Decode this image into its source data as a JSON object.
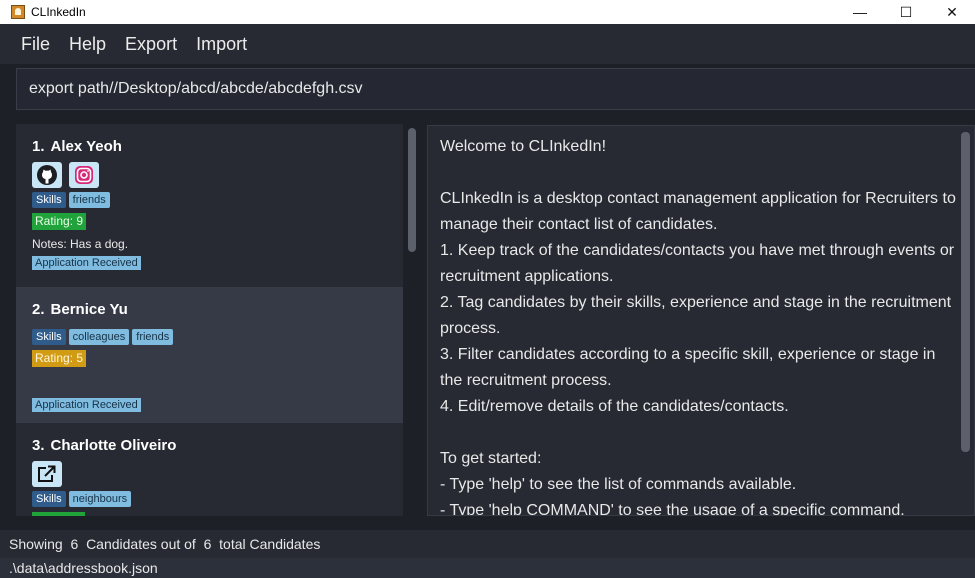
{
  "window": {
    "title": "CLInkedIn",
    "minimize": "—",
    "maximize": "☐",
    "close": "✕"
  },
  "menu": [
    "File",
    "Help",
    "Export",
    "Import"
  ],
  "command": {
    "value": "export path//Desktop/abcd/abcde/abcdefgh.csv"
  },
  "candidates": [
    {
      "index": "1.",
      "name": "Alex Yeoh",
      "socials": [
        "github-icon",
        "instagram-icon"
      ],
      "tags": [
        "Skills",
        "friends"
      ],
      "rating": "Rating: 9",
      "rating_color": "#1fa33a",
      "notes": "Notes: Has a dog.",
      "stage": "Application Received"
    },
    {
      "index": "2.",
      "name": "Bernice Yu",
      "socials": [],
      "tags": [
        "Skills",
        "colleagues",
        "friends"
      ],
      "rating": "Rating: 5",
      "rating_color": "#d29b14",
      "notes": "",
      "stage": "Application Received"
    },
    {
      "index": "3.",
      "name": "Charlotte Oliveiro",
      "socials": [
        "external-link-icon"
      ],
      "tags": [
        "Skills",
        "neighbours"
      ],
      "rating": "",
      "rating_color": "#1fa33a",
      "notes": "",
      "stage": ""
    }
  ],
  "result": {
    "text": "Welcome to CLInkedIn!\n\nCLInkedIn is a desktop contact management application for Recruiters to manage their contact list of candidates.\n1. Keep track of the candidates/contacts you have met through events or recruitment applications.\n2. Tag candidates by their skills, experience and stage in the recruitment process.\n3. Filter candidates according to a specific skill, experience or stage in the recruitment process.\n4. Edit/remove details of the candidates/contacts.\n\nTo get started:\n- Type 'help' to see the list of commands available.\n- Type 'help COMMAND' to see the usage of a specific command."
  },
  "status": {
    "prefix": "Showing",
    "shown": "6",
    "middle": "Candidates out of",
    "total": "6",
    "suffix": "total Candidates"
  },
  "footer": {
    "path": ".\\data\\addressbook.json"
  }
}
